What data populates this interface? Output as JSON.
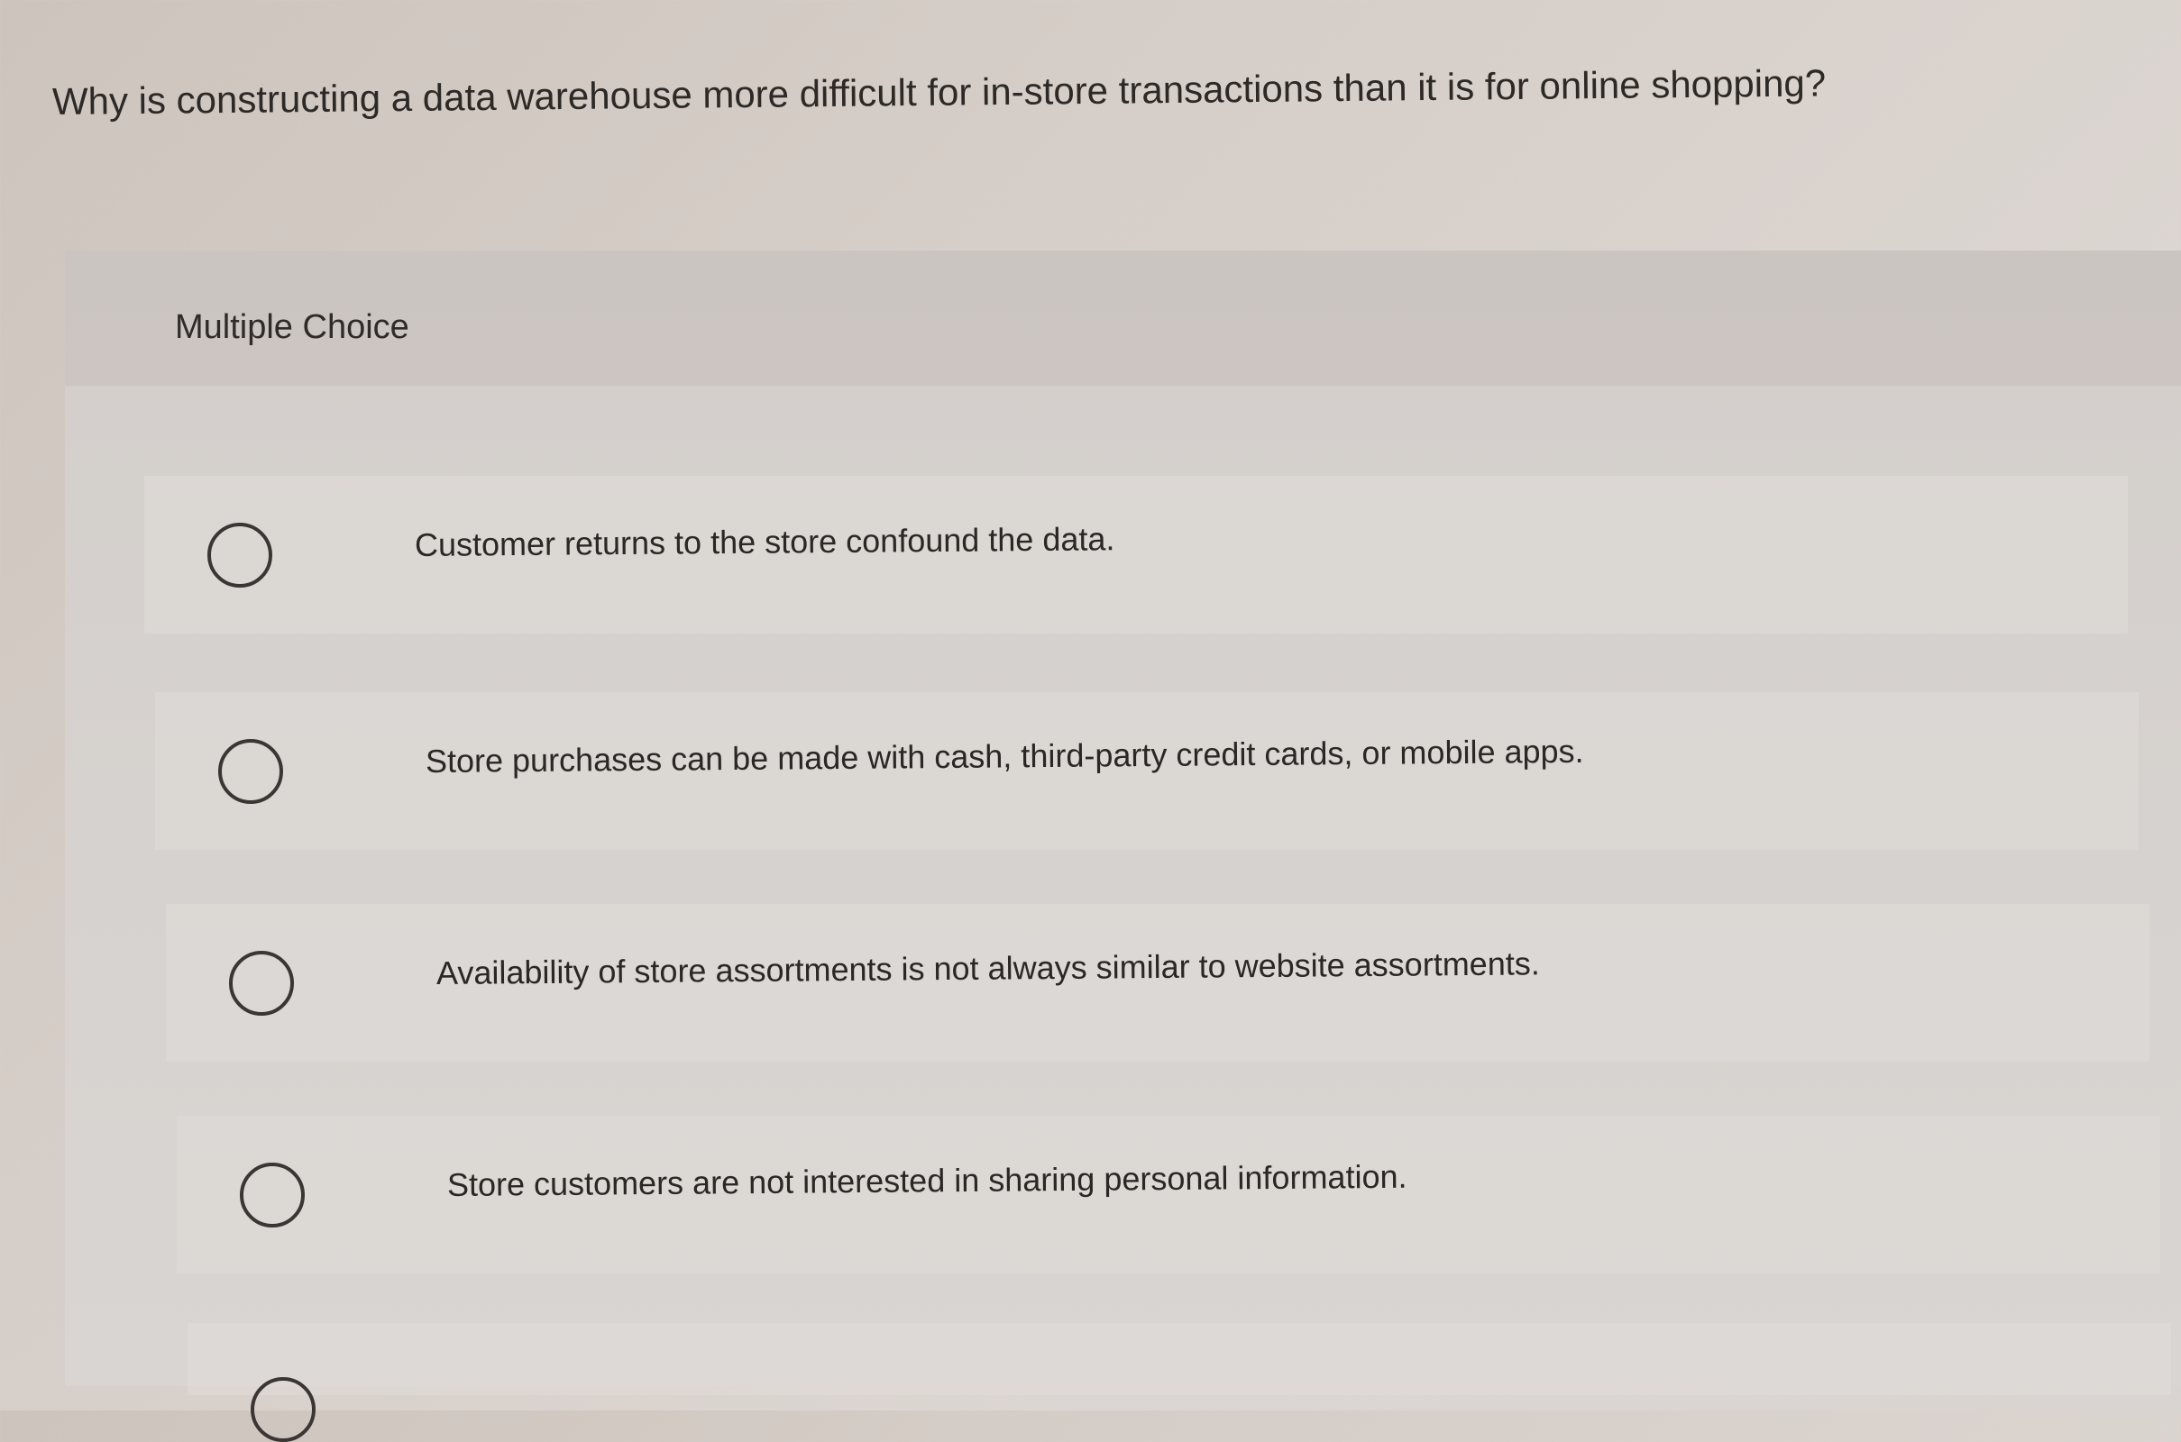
{
  "question": {
    "text": "Why is constructing a data warehouse more difficult for in-store transactions than it is for online shopping?"
  },
  "panel": {
    "type_label": "Multiple Choice"
  },
  "options": [
    {
      "text": "Customer returns to the store confound the data."
    },
    {
      "text": "Store purchases can be made with cash, third-party credit cards, or mobile apps."
    },
    {
      "text": "Availability of store assortments is not always similar to website assortments."
    },
    {
      "text": "Store customers are not interested in sharing personal information."
    },
    {
      "text": ""
    }
  ]
}
